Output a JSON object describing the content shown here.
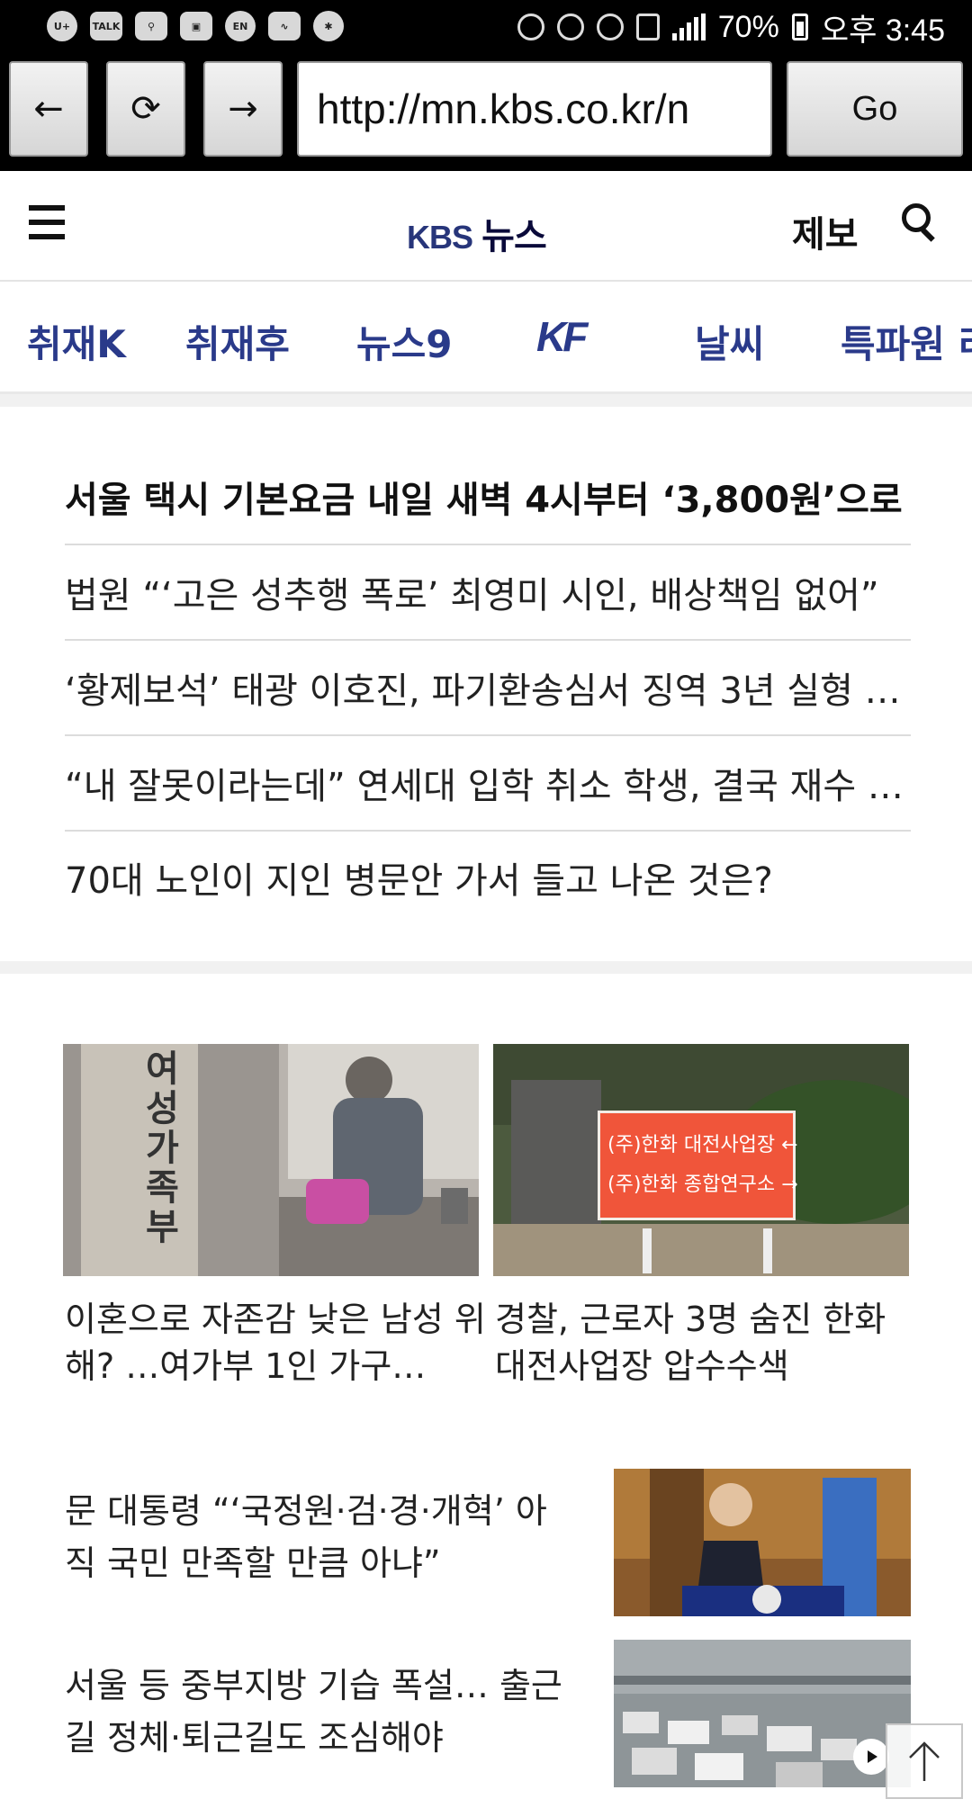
{
  "status_bar": {
    "left_icons": [
      "U+",
      "TALK",
      "usb",
      "tv",
      "EN",
      "pulse",
      "bug"
    ],
    "battery": "70%",
    "time": "오후 3:45"
  },
  "browser": {
    "back_icon": "←",
    "reload_icon": "⟳",
    "forward_icon": "→",
    "url": "http://mn.kbs.co.kr/n",
    "go_label": "Go"
  },
  "site": {
    "logo_kbs": "KBS",
    "logo_news": "뉴스",
    "report_label": "제보",
    "categories": [
      "취재K",
      "취재후",
      "뉴스9",
      "K",
      "날씨",
      "특파원 리"
    ]
  },
  "headlines": [
    "서울 택시 기본요금 내일 새벽 4시부터 ‘3,800원’으로 …",
    "법원 “‘고은 성추행 폭로’ 최영미 시인, 배상책임 없어”",
    "‘황제보석’ 태광 이호진, 파기환송심서 징역 3년 실형 …",
    "“내 잘못이라는데” 연세대 입학 취소 학생, 결국 재수 …",
    "70대 노인이 지인 병문안 가서 들고 나온 것은?"
  ],
  "photo_cards": [
    {
      "title": "이혼으로 자존감 낮은 남성 위해? …여가부 1인 가구…",
      "image_sign": "여성가족부"
    },
    {
      "title": "경찰, 근로자 3명 숨진 한화 대전사업장 압수수색",
      "image_sign_1": "(주)한화 대전사업장 ←",
      "image_sign_2": "(주)한화 종합연구소 →"
    }
  ],
  "side_stories": [
    {
      "title": "문 대통령 “‘국정원·검·경·개혁’ 아직 국민 만족할 만큼 아냐”"
    },
    {
      "title": "서울 등 중부지방 기습 폭설… 출근길 정체·퇴근길도 조심해야"
    }
  ],
  "colors": {
    "brand": "#2a3a8a",
    "statusbar": "#000000",
    "sign_orange": "#f0553a"
  }
}
